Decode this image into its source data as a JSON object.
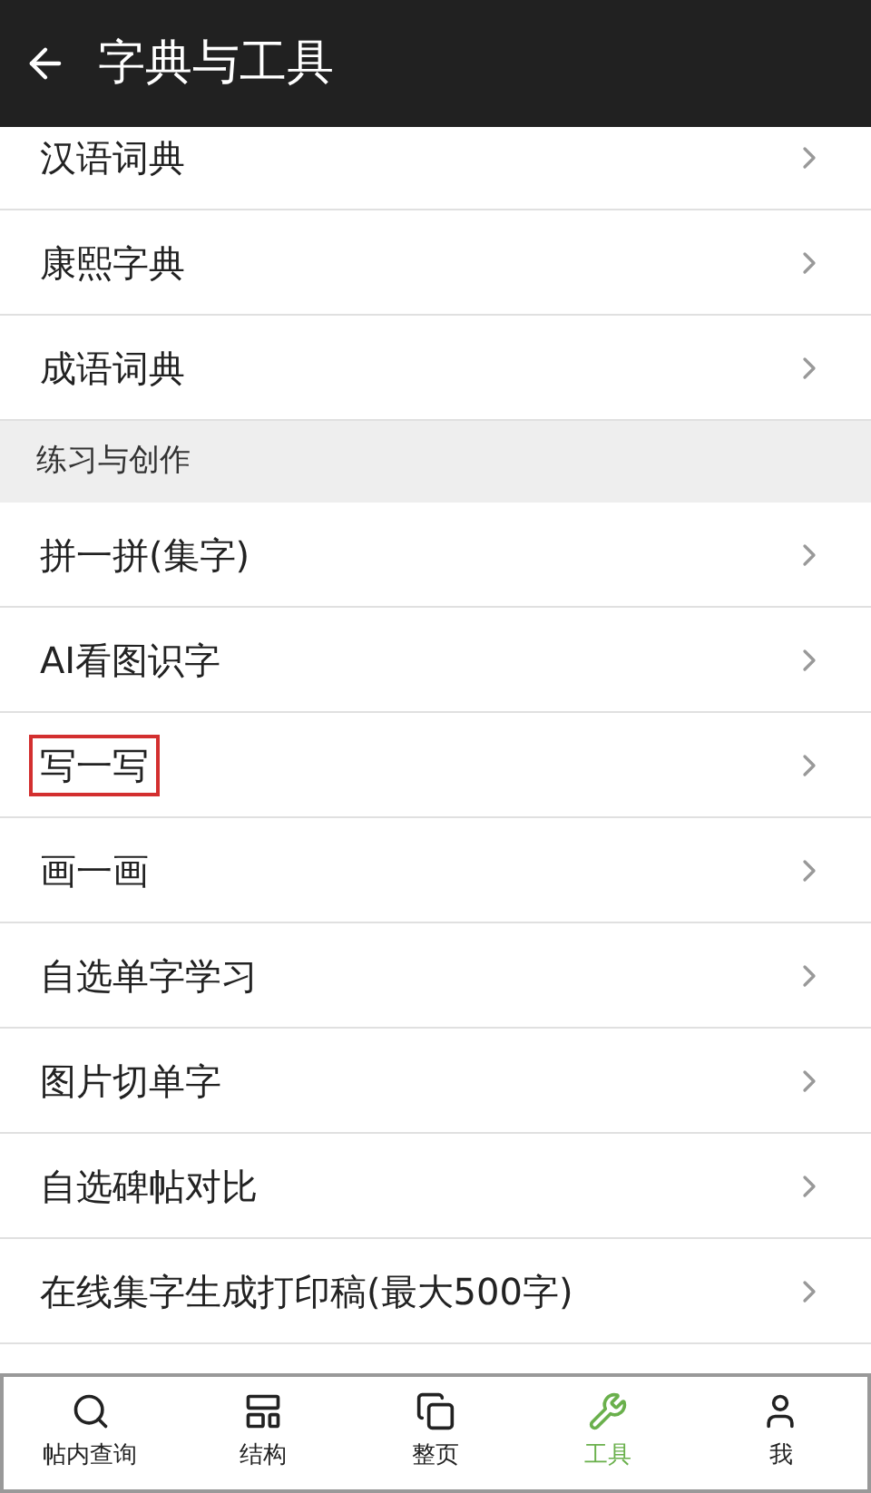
{
  "header": {
    "title": "字典与工具"
  },
  "sections": [
    {
      "items": [
        {
          "label": "汉语词典",
          "highlighted": false
        },
        {
          "label": "康熙字典",
          "highlighted": false
        },
        {
          "label": "成语词典",
          "highlighted": false
        }
      ]
    },
    {
      "heading": "练习与创作",
      "items": [
        {
          "label": "拼一拼(集字)",
          "highlighted": false
        },
        {
          "label": "AI看图识字",
          "highlighted": false
        },
        {
          "label": "写一写",
          "highlighted": true
        },
        {
          "label": "画一画",
          "highlighted": false
        },
        {
          "label": "自选单字学习",
          "highlighted": false
        },
        {
          "label": "图片切单字",
          "highlighted": false
        },
        {
          "label": "自选碑帖对比",
          "highlighted": false
        },
        {
          "label": "在线集字生成打印稿(最大500字)",
          "highlighted": false
        }
      ]
    }
  ],
  "tab_bar": [
    {
      "label": "帖内查询",
      "kind": "search",
      "selected": false
    },
    {
      "label": "结构",
      "kind": "structure",
      "selected": false
    },
    {
      "label": "整页",
      "kind": "page",
      "selected": false
    },
    {
      "label": "工具",
      "kind": "tools",
      "selected": true
    },
    {
      "label": "我",
      "kind": "me",
      "selected": false
    }
  ]
}
